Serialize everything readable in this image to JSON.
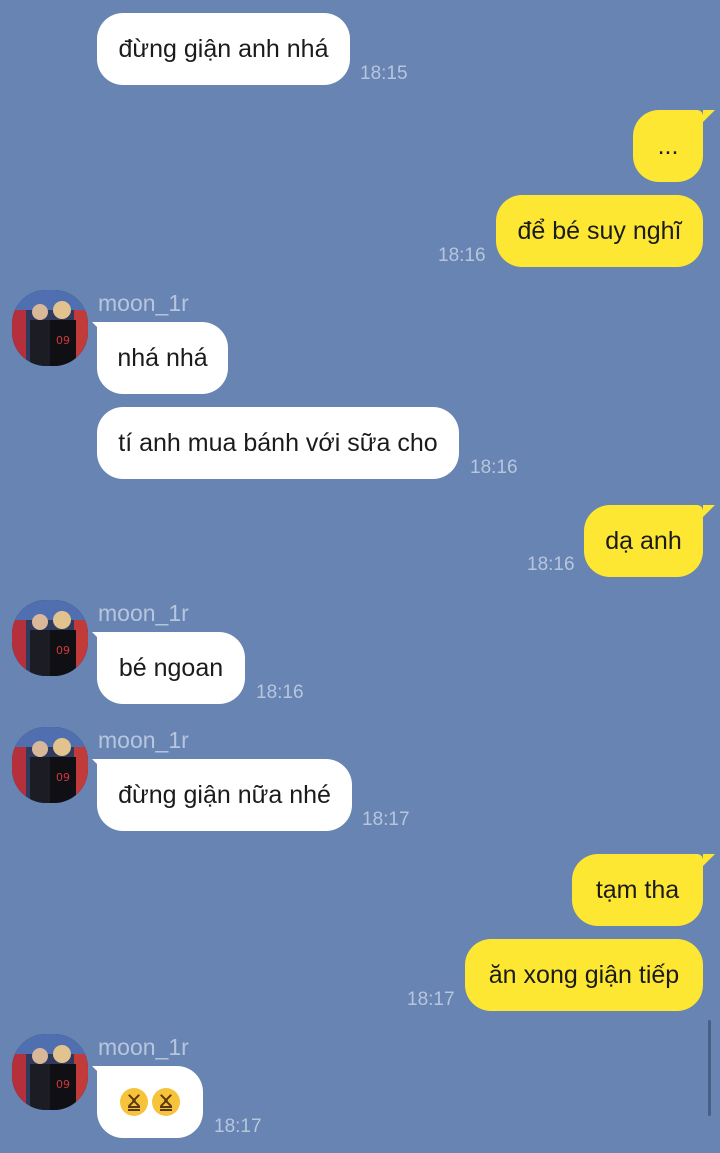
{
  "colors": {
    "background": "#6784b2",
    "incoming_bubble": "#ffffff",
    "outgoing_bubble": "#fde732",
    "meta_text": "#b7c6de"
  },
  "messages": [
    {
      "dir": "in",
      "text": "đừng giận anh nhá",
      "time": "18:15"
    },
    {
      "dir": "out",
      "text": "...",
      "time": ""
    },
    {
      "dir": "out",
      "text": "để bé suy nghĩ",
      "time": "18:16"
    },
    {
      "dir": "in",
      "sender": "moon_1r",
      "text": "nhá nhá",
      "time": ""
    },
    {
      "dir": "in",
      "text": "tí anh mua bánh với sữa cho",
      "time": "18:16"
    },
    {
      "dir": "out",
      "text": "dạ anh",
      "time": "18:16"
    },
    {
      "dir": "in",
      "sender": "moon_1r",
      "text": "bé ngoan",
      "time": "18:16"
    },
    {
      "dir": "in",
      "sender": "moon_1r",
      "text": "đừng giận nữa nhé",
      "time": "18:17"
    },
    {
      "dir": "out",
      "text": "tạm tha",
      "time": ""
    },
    {
      "dir": "out",
      "text": "ăn xong giận tiếp",
      "time": "18:17"
    },
    {
      "dir": "in",
      "sender": "moon_1r",
      "text": "",
      "emoji": [
        "confounded-face-emoji",
        "confounded-face-emoji"
      ],
      "time": "18:17"
    }
  ]
}
